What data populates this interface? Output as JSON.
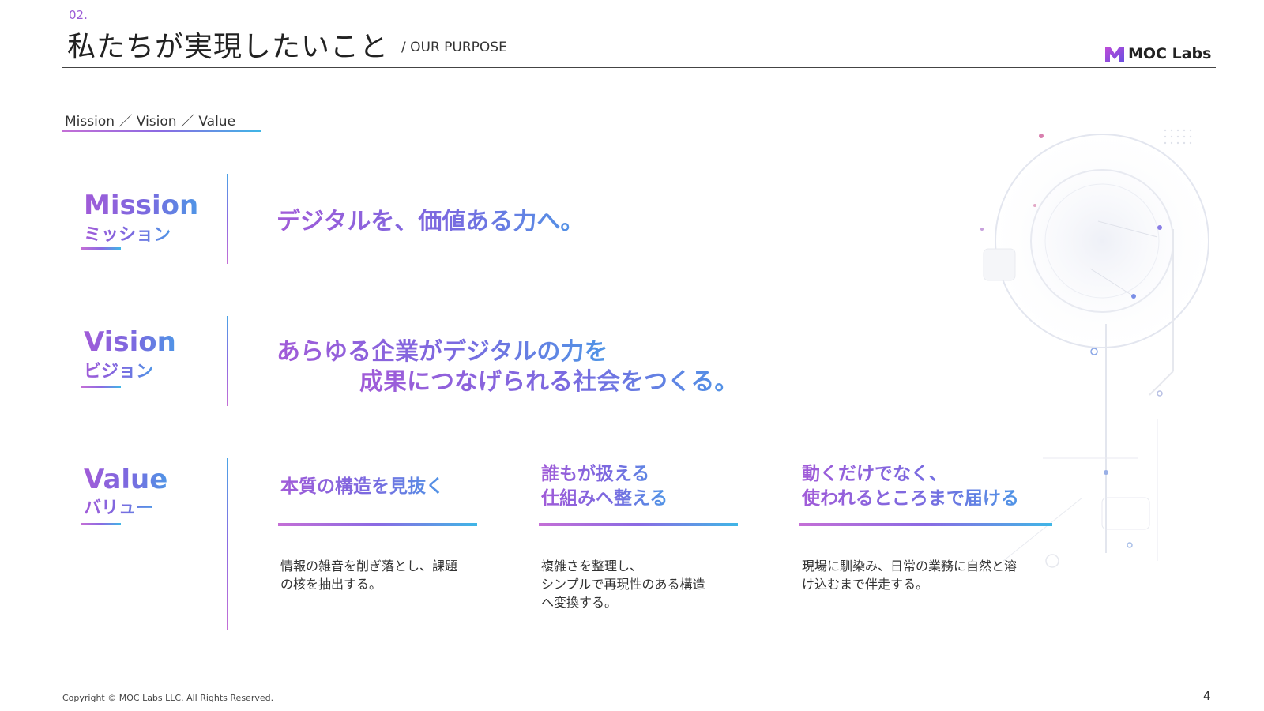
{
  "header": {
    "section_number": "02.",
    "title": "私たちが実現したいこと",
    "subtitle": "/ OUR PURPOSE",
    "logo_text": "MOC Labs"
  },
  "tabs": {
    "label": "Mission ／ Vision ／ Value"
  },
  "mission": {
    "title": "Mission",
    "kana": "ミッション",
    "statement": "デジタルを、価値ある力へ。"
  },
  "vision": {
    "title": "Vision",
    "kana": "ビジョン",
    "statement_line1": "あらゆる企業がデジタルの力を",
    "statement_line2": "成果につなげられる社会をつくる。"
  },
  "value": {
    "title": "Value",
    "kana": "バリュー",
    "items": [
      {
        "heading": [
          "本質の構造を見抜く"
        ],
        "body": [
          "情報の雑音を削ぎ落とし、課題",
          "の核を抽出する。"
        ]
      },
      {
        "heading": [
          "誰もが扱える",
          "仕組みへ整える"
        ],
        "body": [
          "複雑さを整理し、",
          "シンプルで再現性のある構造",
          "へ変換する。"
        ]
      },
      {
        "heading": [
          "動くだけでなく、",
          "使われるところまで届ける"
        ],
        "body": [
          "現場に馴染み、日常の業務に自然と溶",
          "け込むまで伴走する。"
        ]
      }
    ]
  },
  "footer": {
    "copyright": "Copyright © MOC Labs LLC. All Rights Reserved.",
    "page_number": "4"
  },
  "colors": {
    "accent_purple": "#a15bd8",
    "accent_blue": "#4f95e6",
    "accent_cyan": "#3fb6e6"
  }
}
